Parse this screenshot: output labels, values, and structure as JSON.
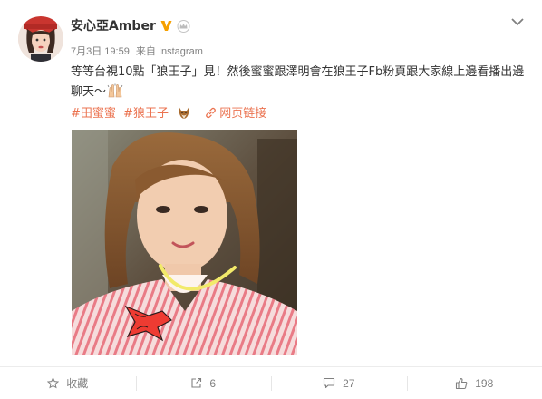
{
  "user": {
    "name": "安心亞Amber",
    "badge_color": "#f6a000",
    "crown_color": "#c8c8c8"
  },
  "post": {
    "time": "7月3日 19:59",
    "source": "来自 Instagram",
    "text": "等等台視10點「狼王子」見！然後蜜蜜跟澤明會在狼王子Fb粉頁跟大家線上邊看播出邊聊天～",
    "tags": [
      "#田蜜蜜",
      "#狼王子"
    ],
    "link_label": "网页链接",
    "tag_color": "#eb7350"
  },
  "actions": {
    "favorite": "收藏",
    "repost": "6",
    "comment": "27",
    "like": "198"
  },
  "icons": {
    "menu": "chevron-down-icon",
    "verified": "verified-icon",
    "crown": "crown-icon",
    "emoji_hands": "raised-hands-emoji",
    "emoji_wolf": "wolf-emoji",
    "link": "link-icon",
    "favorite": "star-icon",
    "repost": "repost-icon",
    "comment": "comment-icon",
    "like": "thumbs-up-icon"
  }
}
